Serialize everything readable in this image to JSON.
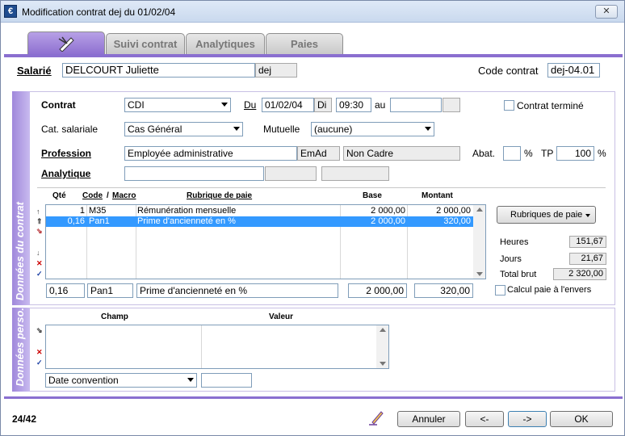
{
  "window": {
    "title": "Modification contrat dej du 01/02/04",
    "close_label": "✕"
  },
  "tabs": [
    {
      "label": "",
      "icon": "pen-icon"
    },
    {
      "label": "Suivi contrat"
    },
    {
      "label": "Analytiques"
    },
    {
      "label": "Paies"
    }
  ],
  "header": {
    "salarie_label": "Salarié",
    "salarie_name": "DELCOURT Juliette",
    "salarie_code": "dej",
    "code_contrat_label": "Code contrat",
    "code_contrat_value": "dej-04.01"
  },
  "contract": {
    "section_label": "Données du contrat",
    "contrat_label": "Contrat",
    "contrat_value": "CDI",
    "du_label": "Du",
    "du_date": "01/02/04",
    "du_day": "Di",
    "du_time": "09:30",
    "au_label": "au",
    "au_date": "",
    "au_day": "",
    "termine_label": "Contrat terminé",
    "cat_label": "Cat. salariale",
    "cat_value": "Cas Général",
    "mutuelle_label": "Mutuelle",
    "mutuelle_value": "(aucune)",
    "profession_label": "Profession",
    "profession_value": "Employée administrative",
    "profession_code": "EmAd",
    "profession_statut": "Non Cadre",
    "abat_label": "Abat.",
    "abat_value": "",
    "pct1": "%",
    "tp_label": "TP",
    "tp_value": "100",
    "pct2": "%",
    "analytique_label": "Analytique"
  },
  "rubriques": {
    "headers": {
      "qte": "Qté",
      "code": "Code",
      "macro": "Macro",
      "rubrique": "Rubrique de paie",
      "base": "Base",
      "montant": "Montant"
    },
    "rows": [
      {
        "qte": "1",
        "code": "M35",
        "rubrique": "Rémunération mensuelle",
        "base": "2 000,00",
        "montant": "2 000,00",
        "selected": false
      },
      {
        "qte": "0,16",
        "code": "Pan1",
        "rubrique": "Prime d'ancienneté en %",
        "base": "2 000,00",
        "montant": "320,00",
        "selected": true
      }
    ],
    "edit": {
      "qte": "0,16",
      "code": "Pan1",
      "rubrique": "Prime d'ancienneté en %",
      "base": "2 000,00",
      "montant": "320,00"
    },
    "button_label": "Rubriques de paie",
    "heures_label": "Heures",
    "heures_value": "151,67",
    "jours_label": "Jours",
    "jours_value": "21,67",
    "total_label": "Total brut",
    "total_value": "2 320,00",
    "calcul_label": "Calcul paie à l'envers"
  },
  "perso": {
    "section_label": "Données perso.",
    "champ_header": "Champ",
    "valeur_header": "Valeur",
    "select_value": "Date convention",
    "input_value": ""
  },
  "footer": {
    "counter": "24/42",
    "annuler": "Annuler",
    "prev": "<-",
    "next": "->",
    "ok": "OK"
  },
  "colors": {
    "accent": "#8a6fd0",
    "selection": "#3399ff"
  }
}
